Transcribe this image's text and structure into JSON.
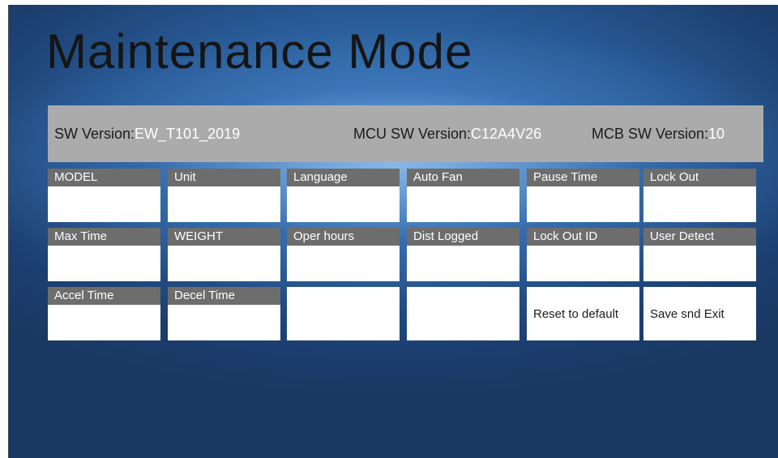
{
  "title": "Maintenance Mode",
  "versions": {
    "sw": {
      "label": "SW Version:",
      "value": "EW_T101_2019"
    },
    "mcu": {
      "label": "MCU SW Version:",
      "value": "C12A4V26"
    },
    "mcb": {
      "label": "MCB SW Version:",
      "value": "10"
    }
  },
  "params": [
    {
      "label": "MODEL",
      "value": ""
    },
    {
      "label": "Unit",
      "value": ""
    },
    {
      "label": "Language",
      "value": ""
    },
    {
      "label": "Auto Fan",
      "value": ""
    },
    {
      "label": "Pause Time",
      "value": ""
    },
    {
      "label": "Lock Out",
      "value": ""
    },
    {
      "label": "Max Time",
      "value": ""
    },
    {
      "label": "WEIGHT",
      "value": ""
    },
    {
      "label": "Oper hours",
      "value": ""
    },
    {
      "label": "Dist Logged",
      "value": ""
    },
    {
      "label": "Lock Out ID",
      "value": ""
    },
    {
      "label": "User Detect",
      "value": ""
    },
    {
      "label": "Accel Time",
      "value": ""
    },
    {
      "label": "Decel Time",
      "value": ""
    }
  ],
  "buttons": {
    "reset": "Reset to default",
    "save": "Save snd Exit"
  }
}
